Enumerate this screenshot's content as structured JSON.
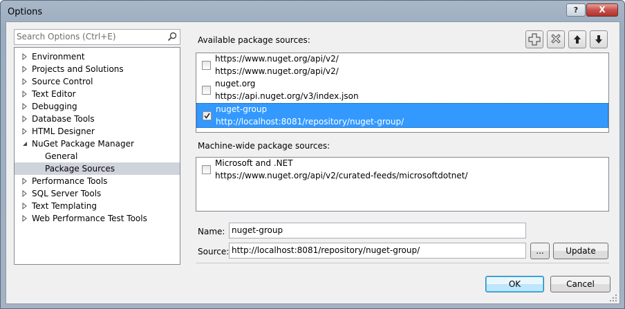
{
  "window": {
    "title": "Options",
    "help_label": "?",
    "close_label": "X"
  },
  "search": {
    "placeholder": "Search Options (Ctrl+E)"
  },
  "tree": {
    "items": [
      {
        "label": "Environment",
        "expandable": true,
        "level": 0,
        "selected": false
      },
      {
        "label": "Projects and Solutions",
        "expandable": true,
        "level": 0,
        "selected": false
      },
      {
        "label": "Source Control",
        "expandable": true,
        "level": 0,
        "selected": false
      },
      {
        "label": "Text Editor",
        "expandable": true,
        "level": 0,
        "selected": false
      },
      {
        "label": "Debugging",
        "expandable": true,
        "level": 0,
        "selected": false
      },
      {
        "label": "Database Tools",
        "expandable": true,
        "level": 0,
        "selected": false
      },
      {
        "label": "HTML Designer",
        "expandable": true,
        "level": 0,
        "selected": false
      },
      {
        "label": "NuGet Package Manager",
        "expandable": true,
        "expanded": true,
        "level": 0,
        "selected": false
      },
      {
        "label": "General",
        "expandable": false,
        "level": 1,
        "selected": false
      },
      {
        "label": "Package Sources",
        "expandable": false,
        "level": 1,
        "selected": true
      },
      {
        "label": "Performance Tools",
        "expandable": true,
        "level": 0,
        "selected": false
      },
      {
        "label": "SQL Server Tools",
        "expandable": true,
        "level": 0,
        "selected": false
      },
      {
        "label": "Text Templating",
        "expandable": true,
        "level": 0,
        "selected": false
      },
      {
        "label": "Web Performance Test Tools",
        "expandable": true,
        "level": 0,
        "selected": false
      }
    ]
  },
  "available": {
    "label": "Available package sources:",
    "sources": [
      {
        "name": "https://www.nuget.org/api/v2/",
        "url": "https://www.nuget.org/api/v2/",
        "checked": false,
        "selected": false
      },
      {
        "name": "nuget.org",
        "url": "https://api.nuget.org/v3/index.json",
        "checked": false,
        "selected": false
      },
      {
        "name": "nuget-group",
        "url": "http://localhost:8081/repository/nuget-group/",
        "checked": true,
        "selected": true
      }
    ]
  },
  "machine": {
    "label": "Machine-wide package sources:",
    "sources": [
      {
        "name": "Microsoft and .NET",
        "url": "https://www.nuget.org/api/v2/curated-feeds/microsoftdotnet/",
        "checked": false
      }
    ]
  },
  "toolbar": {
    "icons": [
      "add-icon",
      "remove-icon",
      "move-up-icon",
      "move-down-icon"
    ]
  },
  "form": {
    "name_label": "Name:",
    "name_value": "nuget-group",
    "source_label": "Source:",
    "source_value": "http://localhost:8081/repository/nuget-group/",
    "browse_label": "...",
    "update_label": "Update"
  },
  "footer": {
    "ok_label": "OK",
    "cancel_label": "Cancel"
  },
  "colors": {
    "selection": "#3399ff",
    "tree_selection": "#cfd3dc",
    "title_bar": "#a9b8c8",
    "close_button": "#c75050"
  }
}
